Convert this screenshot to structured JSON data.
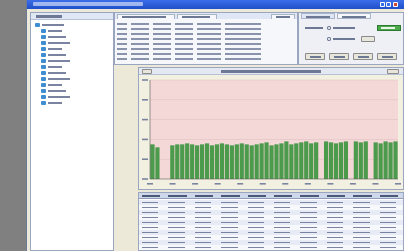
{
  "window": {
    "title": ""
  },
  "nav": {
    "header": "",
    "items": [
      {
        "label": "",
        "depth": 0
      },
      {
        "label": "",
        "depth": 1
      },
      {
        "label": "",
        "depth": 1
      },
      {
        "label": "",
        "depth": 1
      },
      {
        "label": "",
        "depth": 1
      },
      {
        "label": "",
        "depth": 1
      },
      {
        "label": "",
        "depth": 1
      },
      {
        "label": "",
        "depth": 1
      },
      {
        "label": "",
        "depth": 1
      },
      {
        "label": "",
        "depth": 1
      },
      {
        "label": "",
        "depth": 1
      },
      {
        "label": "",
        "depth": 1
      },
      {
        "label": "",
        "depth": 1
      },
      {
        "label": "",
        "depth": 1
      }
    ]
  },
  "top_grid": {
    "tabs": [
      "",
      "",
      ""
    ],
    "rows": [
      [
        "",
        "",
        "",
        "",
        "",
        ""
      ],
      [
        "",
        "",
        "",
        "",
        "",
        ""
      ],
      [
        "",
        "",
        "",
        "",
        "",
        ""
      ],
      [
        "",
        "",
        "",
        "",
        "",
        ""
      ],
      [
        "",
        "",
        "",
        "",
        "",
        ""
      ],
      [
        "",
        "",
        "",
        "",
        "",
        ""
      ],
      [
        "",
        "",
        "",
        "",
        "",
        ""
      ],
      [
        "",
        "",
        "",
        "",
        "",
        ""
      ]
    ]
  },
  "right_panel": {
    "tabs": [
      "",
      ""
    ],
    "options": [
      "",
      ""
    ],
    "status_label": "",
    "buttons": [
      "",
      "",
      "",
      ""
    ]
  },
  "chart_data": {
    "type": "bar",
    "title": "",
    "xlabel": "",
    "ylabel": "",
    "ylim": [
      0,
      100
    ],
    "bar_color": "#4c9a4c",
    "background": "#f4d8d8",
    "values": [
      35,
      32,
      0,
      0,
      34,
      35,
      35,
      36,
      35,
      34,
      35,
      36,
      34,
      35,
      36,
      35,
      34,
      35,
      36,
      35,
      34,
      35,
      36,
      37,
      34,
      35,
      36,
      38,
      35,
      36,
      37,
      38,
      36,
      37,
      0,
      38,
      37,
      36,
      37,
      38,
      0,
      38,
      37,
      38,
      0,
      37,
      36,
      38,
      37,
      38
    ]
  },
  "bottom_table": {
    "headers": [
      "",
      "",
      "",
      "",
      "",
      "",
      "",
      "",
      "",
      ""
    ],
    "rows": [
      [
        "",
        "",
        "",
        "",
        "",
        "",
        "",
        "",
        "",
        ""
      ],
      [
        "",
        "",
        "",
        "",
        "",
        "",
        "",
        "",
        "",
        ""
      ],
      [
        "",
        "",
        "",
        "",
        "",
        "",
        "",
        "",
        "",
        ""
      ],
      [
        "",
        "",
        "",
        "",
        "",
        "",
        "",
        "",
        "",
        ""
      ],
      [
        "",
        "",
        "",
        "",
        "",
        "",
        "",
        "",
        "",
        ""
      ],
      [
        "",
        "",
        "",
        "",
        "",
        "",
        "",
        "",
        "",
        ""
      ],
      [
        "",
        "",
        "",
        "",
        "",
        "",
        "",
        "",
        "",
        ""
      ],
      [
        "",
        "",
        "",
        "",
        "",
        "",
        "",
        "",
        "",
        ""
      ],
      [
        "",
        "",
        "",
        "",
        "",
        "",
        "",
        "",
        "",
        ""
      ],
      [
        "",
        "",
        "",
        "",
        "",
        "",
        "",
        "",
        "",
        ""
      ]
    ]
  },
  "colors": {
    "title_bar": "#1f4fc9",
    "window_bg": "#ece9d8",
    "accent_green": "#4caa4c"
  }
}
